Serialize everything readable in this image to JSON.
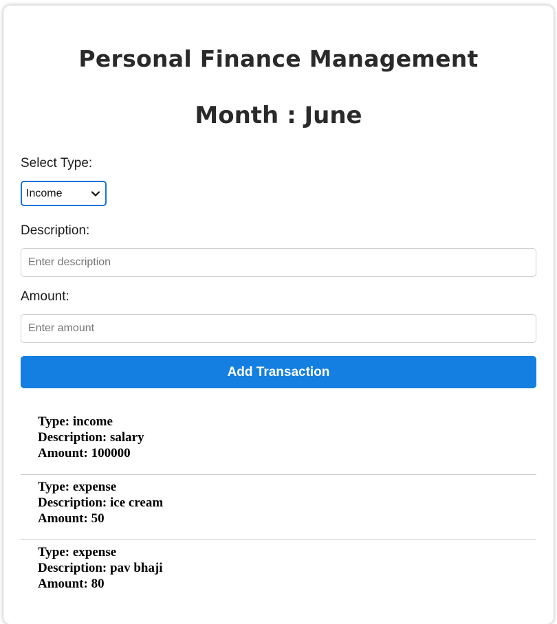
{
  "header": {
    "title": "Personal Finance Management",
    "month_text": "Month : June"
  },
  "form": {
    "type_label": "Select Type:",
    "type_selected": "Income",
    "description_label": "Description:",
    "description_placeholder": "Enter description",
    "amount_label": "Amount:",
    "amount_placeholder": "Enter amount",
    "submit_label": "Add Transaction"
  },
  "colors": {
    "accent": "#147fe0",
    "select_border": "#1a73d9"
  },
  "transactions": [
    {
      "type": "Type: income",
      "description": "Description: salary",
      "amount": "Amount: 100000"
    },
    {
      "type": "Type: expense",
      "description": "Description: ice cream",
      "amount": "Amount: 50"
    },
    {
      "type": "Type: expense",
      "description": "Description: pav bhaji",
      "amount": "Amount: 80"
    }
  ]
}
